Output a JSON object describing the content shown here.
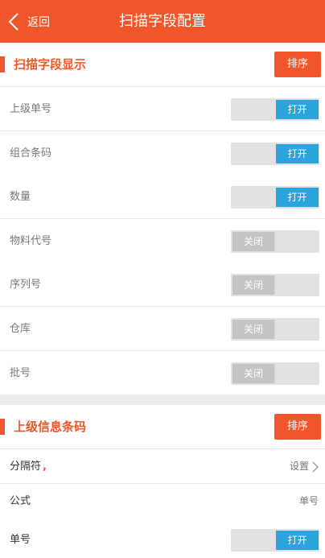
{
  "header": {
    "back_label": "返回",
    "title": "扫描字段配置"
  },
  "section1": {
    "title": "扫描字段显示",
    "sort_label": "排序",
    "rows": [
      {
        "label": "上级单号",
        "state": "on",
        "state_label": "打开"
      },
      {
        "label": "组合条码",
        "state": "on",
        "state_label": "打开"
      },
      {
        "label": "数量",
        "state": "on",
        "state_label": "打开"
      },
      {
        "label": "物料代号",
        "state": "off",
        "state_label": "关闭"
      },
      {
        "label": "序列号",
        "state": "off",
        "state_label": "关闭"
      },
      {
        "label": "仓库",
        "state": "off",
        "state_label": "关闭"
      },
      {
        "label": "批号",
        "state": "off",
        "state_label": "关闭"
      }
    ]
  },
  "section2": {
    "title": "上级信息条码",
    "sort_label": "排序",
    "separator": {
      "label": "分隔符",
      "symbol": ",",
      "action_label": "设置"
    },
    "formula": {
      "label": "公式",
      "value": "单号"
    },
    "order_no": {
      "label": "单号",
      "state": "on",
      "state_label": "打开"
    }
  },
  "colors": {
    "accent": "#f0562a",
    "toggle_on": "#2ba3dc",
    "toggle_off": "#c4c4c4"
  }
}
